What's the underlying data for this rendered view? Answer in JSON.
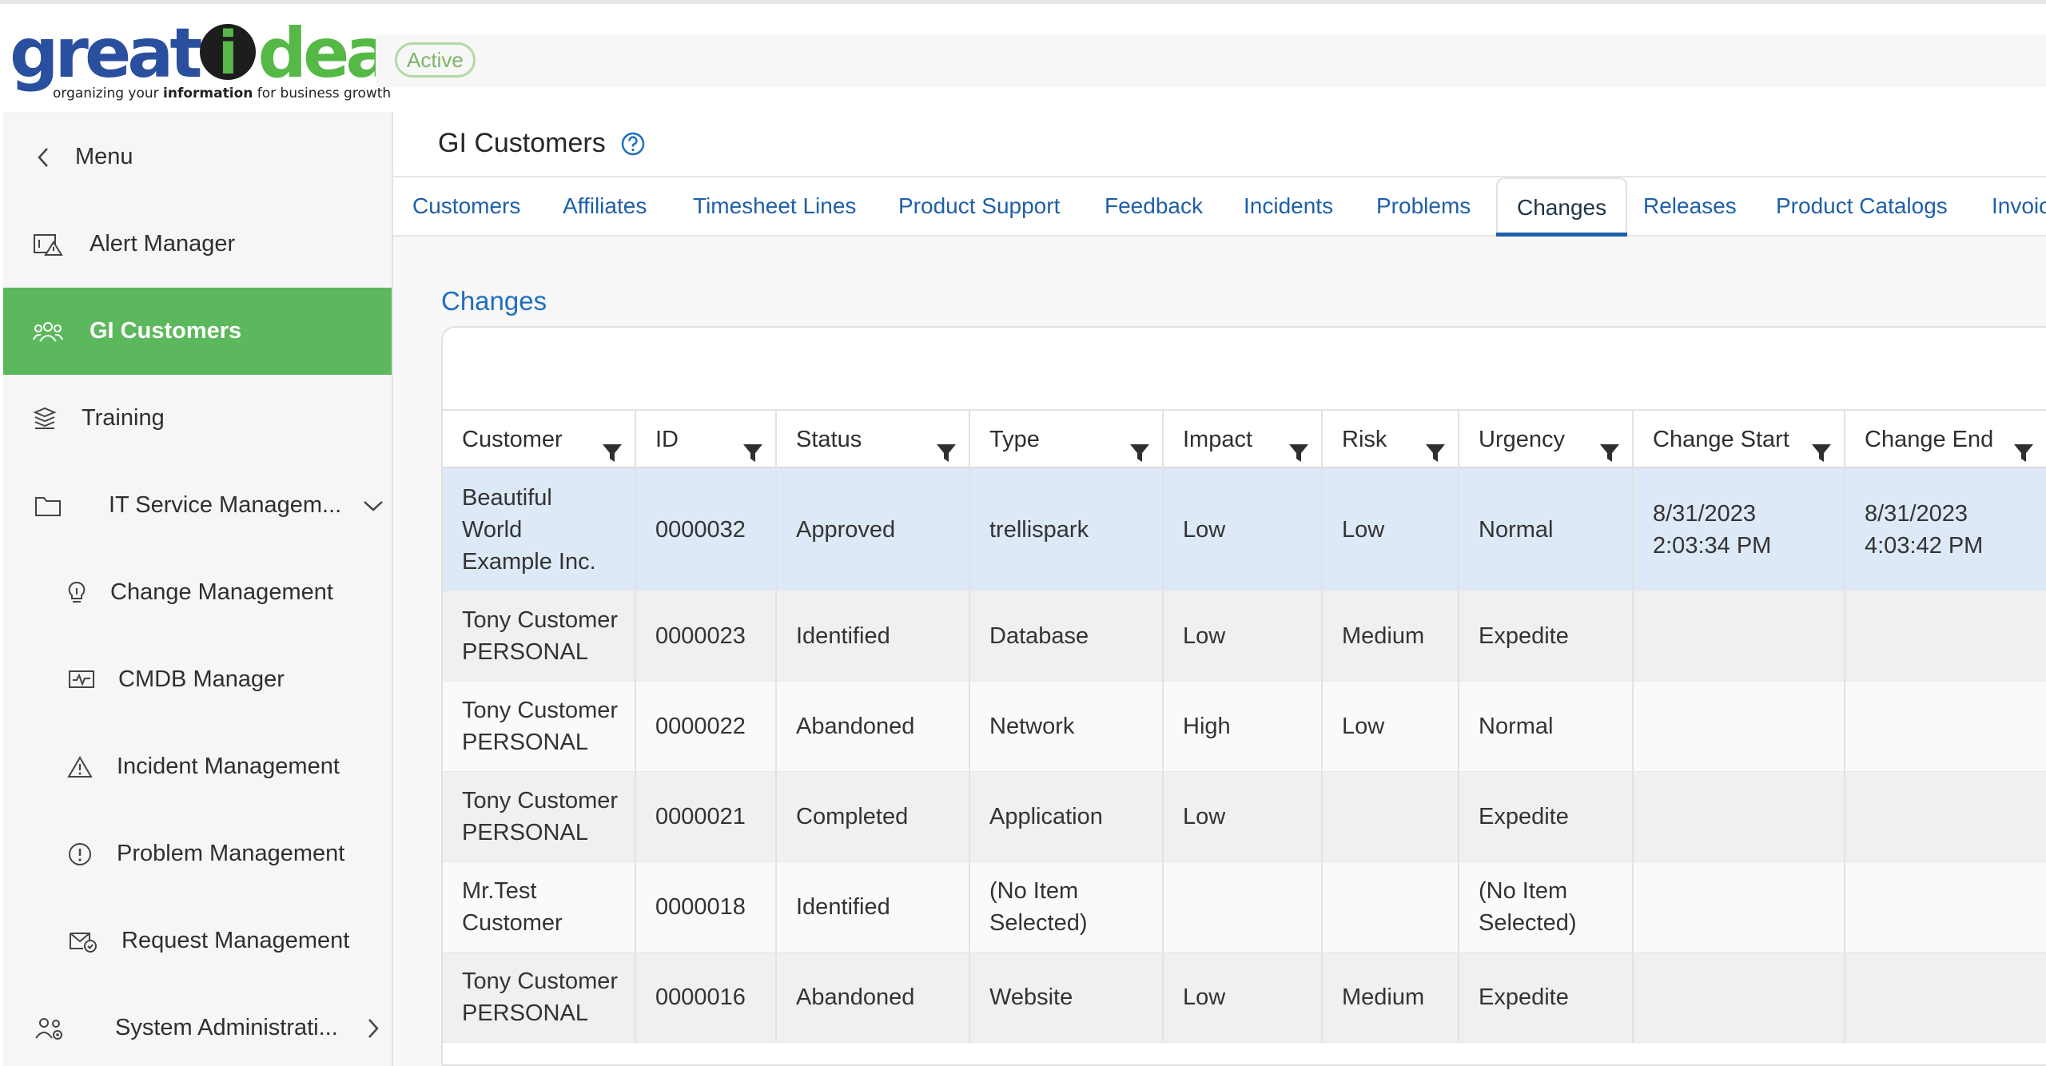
{
  "brand": {
    "logo_part1": "great",
    "logo_i": "i",
    "logo_part2": "deaz",
    "tagline_pre": "organizing your ",
    "tagline_bold": "information",
    "tagline_post": " for business growth",
    "colors": {
      "blue": "#2a4f9e",
      "green": "#56b947"
    }
  },
  "header": {
    "status_badge": "Active"
  },
  "sidebar": {
    "menu_label": "Menu",
    "items": [
      {
        "label": "Alert Manager",
        "icon": "alert-manager-icon"
      },
      {
        "label": "GI Customers",
        "icon": "customers-icon",
        "active": true
      },
      {
        "label": "Training",
        "icon": "training-icon"
      },
      {
        "label": "IT Service Managem...",
        "icon": "folder-icon",
        "expanded": true
      },
      {
        "label": "Change Management",
        "icon": "lightbulb-icon"
      },
      {
        "label": "CMDB Manager",
        "icon": "monitor-icon"
      },
      {
        "label": "Incident Management",
        "icon": "warning-icon"
      },
      {
        "label": "Problem Management",
        "icon": "exclamation-icon"
      },
      {
        "label": "Request Management",
        "icon": "request-icon"
      },
      {
        "label": "System Administrati...",
        "icon": "admin-users-icon"
      }
    ],
    "active_color": "#5cb85c"
  },
  "page": {
    "title": "GI Customers",
    "help_icon": "question-circle-icon"
  },
  "tabs": [
    "Customers",
    "Affiliates",
    "Timesheet Lines",
    "Product Support",
    "Feedback",
    "Incidents",
    "Problems",
    "Changes",
    "Releases",
    "Product Catalogs",
    "Invoic"
  ],
  "active_tab": "Changes",
  "section": {
    "title": "Changes"
  },
  "grid": {
    "columns": [
      "Customer",
      "ID",
      "Status",
      "Type",
      "Impact",
      "Risk",
      "Urgency",
      "Change Start",
      "Change End"
    ],
    "rows": [
      [
        "Beautiful\nWorld\nExample Inc.",
        "0000032",
        "Approved",
        "trellispark",
        "Low",
        "Low",
        "Normal",
        "8/31/2023\n2:03:34 PM",
        "8/31/2023\n4:03:42 PM"
      ],
      [
        "Tony Customer\nPERSONAL",
        "0000023",
        "Identified",
        "Database",
        "Low",
        "Medium",
        "Expedite",
        "",
        ""
      ],
      [
        "Tony Customer\nPERSONAL",
        "0000022",
        "Abandoned",
        "Network",
        "High",
        "Low",
        "Normal",
        "",
        ""
      ],
      [
        "Tony Customer\nPERSONAL",
        "0000021",
        "Completed",
        "Application",
        "Low",
        "",
        "Expedite",
        "",
        ""
      ],
      [
        "Mr.Test\nCustomer",
        "0000018",
        "Identified",
        "(No Item\nSelected)",
        "",
        "",
        "(No Item\nSelected)",
        "",
        ""
      ],
      [
        "Tony Customer\nPERSONAL",
        "0000016",
        "Abandoned",
        "Website",
        "Low",
        "Medium",
        "Expedite",
        "",
        ""
      ]
    ],
    "selected_row": 0
  }
}
